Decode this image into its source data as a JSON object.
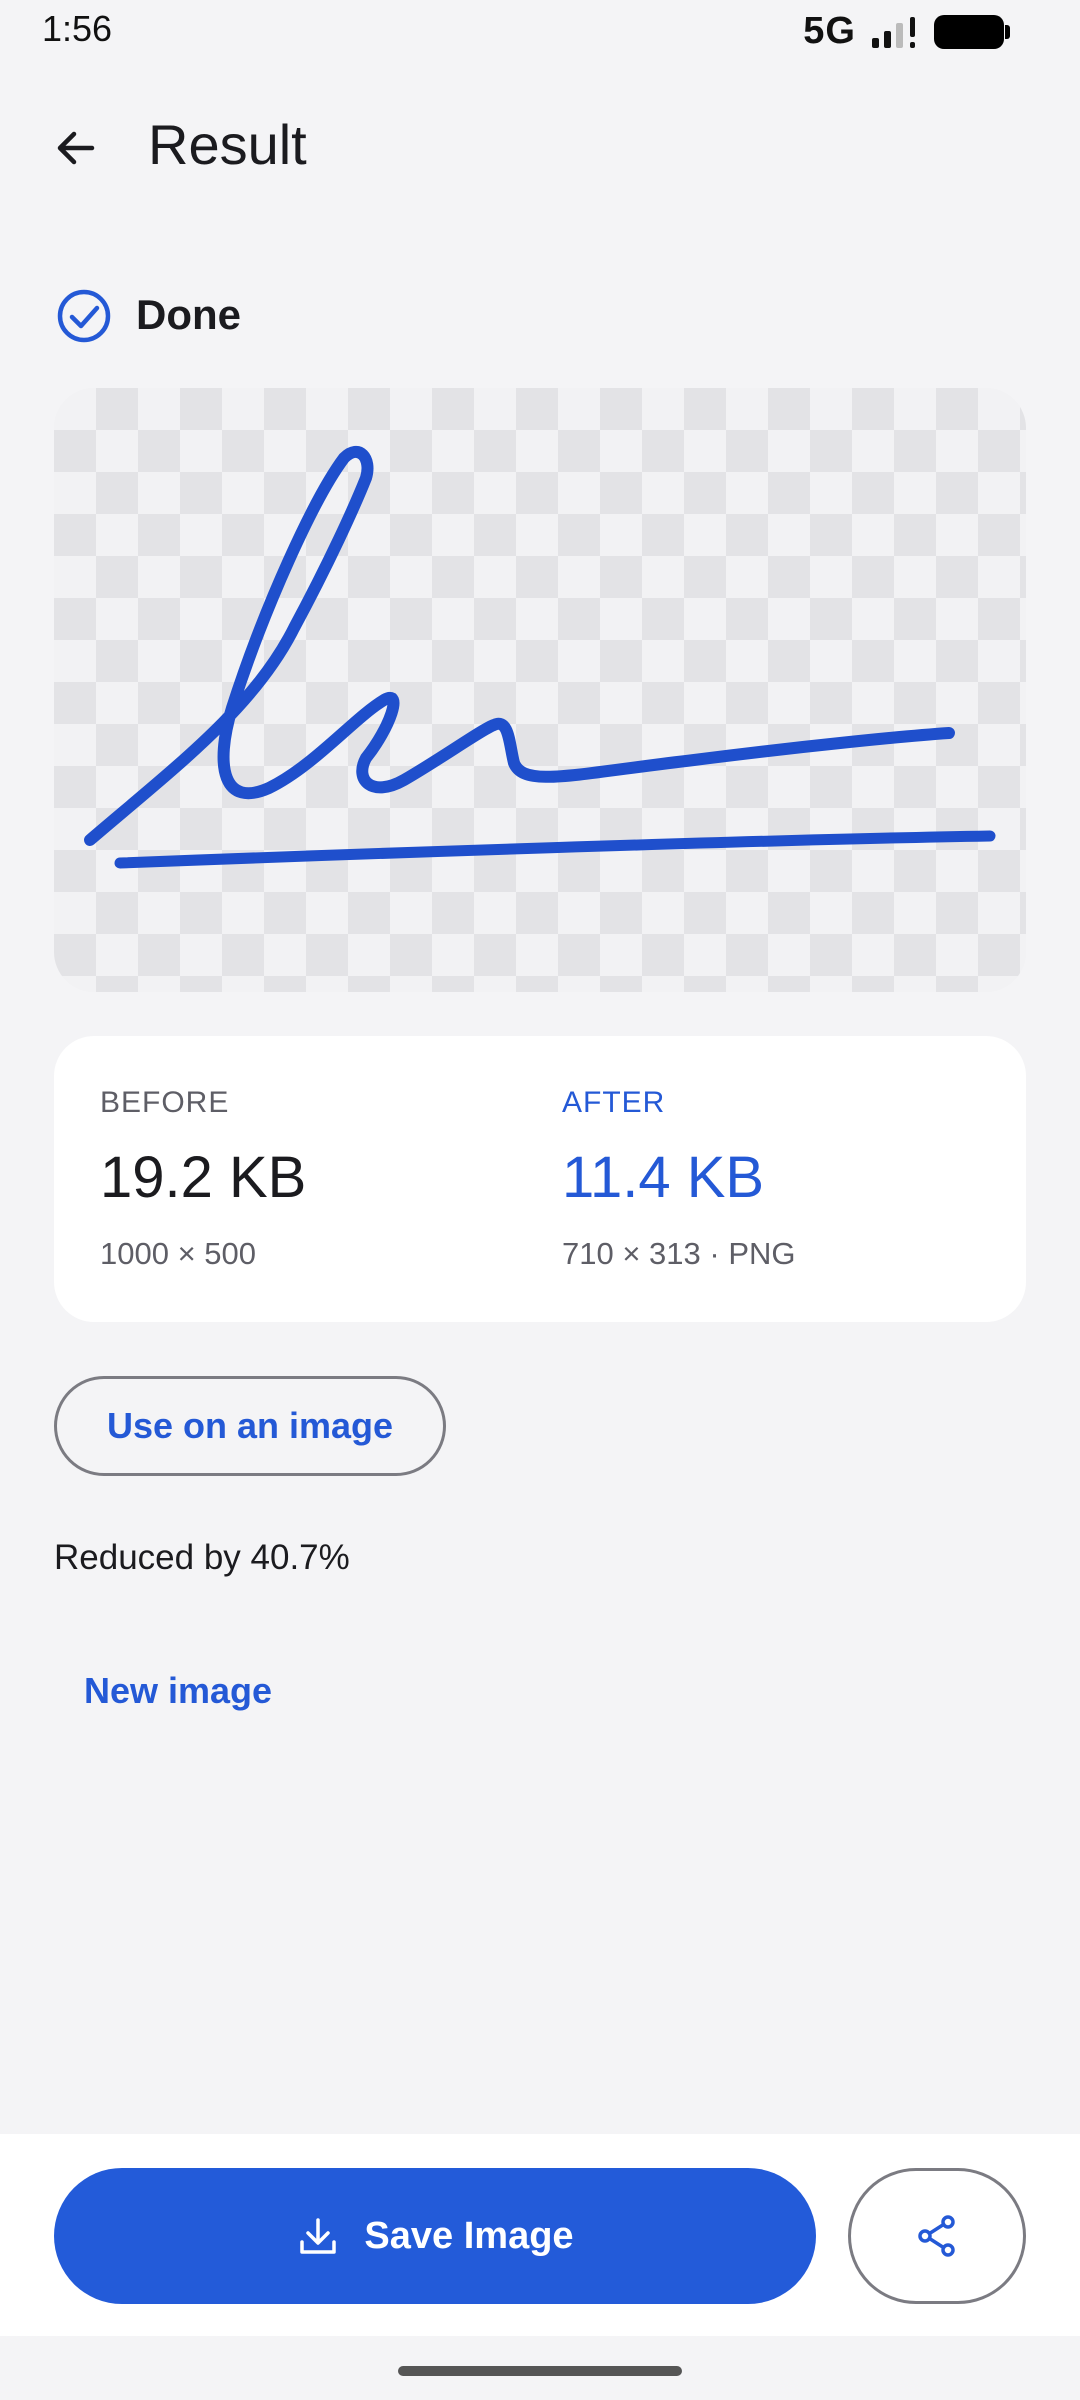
{
  "status": {
    "time": "1:56",
    "network": "5G"
  },
  "header": {
    "title": "Result"
  },
  "status_row": {
    "label": "Done"
  },
  "stats": {
    "before_label": "BEFORE",
    "before_size": "19.2 KB",
    "before_meta": "1000 × 500",
    "after_label": "AFTER",
    "after_size": "11.4 KB",
    "after_meta": "710 × 313 · PNG"
  },
  "actions": {
    "use_on_image": "Use on an image",
    "reduced_text": "Reduced by 40.7%",
    "new_image": "New image",
    "save_label": "Save Image"
  },
  "icons": [
    "arrow-left-icon",
    "check-circle-icon",
    "download-icon",
    "share-icon"
  ],
  "colors": {
    "accent": "#235bd9",
    "background": "#f4f4f6",
    "signature": "#1f4fcc"
  }
}
